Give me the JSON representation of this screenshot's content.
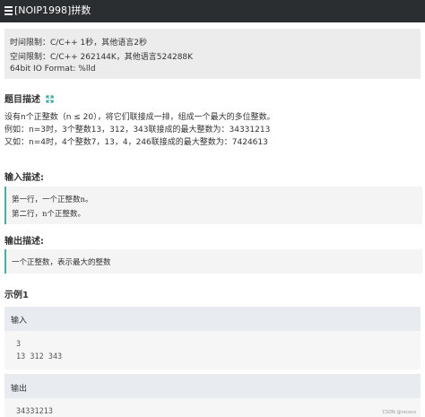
{
  "header": {
    "title": "[NOIP1998]拼数"
  },
  "limits": {
    "time": "时间限制：C/C++ 1秒，其他语言2秒",
    "space": "空间限制：C/C++ 262144K，其他语言524288K",
    "format": "64bit IO Format: %lld"
  },
  "problem": {
    "heading": "题目描述",
    "line1": "设有n个正整数（n ≤ 20），将它们联接成一排，组成一个最大的多位整数。",
    "line2": "例如：n=3时，3个整数13，312，343联接成的最大整数为：34331213",
    "line3": "又如：n=4时，4个整数7，13，4，246联接成的最大整数为：7424613"
  },
  "input_desc": {
    "heading": "输入描述:",
    "line1": "第一行，一个正整数n。",
    "line2": "第二行，n个正整数。"
  },
  "output_desc": {
    "heading": "输出描述:",
    "line1": "一个正整数，表示最大的整数"
  },
  "example": {
    "heading": "示例1",
    "input_label": "输入",
    "input_line1": "3",
    "input_line2": "13 312 343",
    "output_label": "输出",
    "output_value": "34331213"
  },
  "watermark": "CSDN @rococo",
  "colors": {
    "topbar": "#2b2e31",
    "accent": "#3bb3a5",
    "expand_icon": "#2aa198"
  },
  "icons": {
    "menu": "menu-icon",
    "expand": "expand-icon"
  }
}
